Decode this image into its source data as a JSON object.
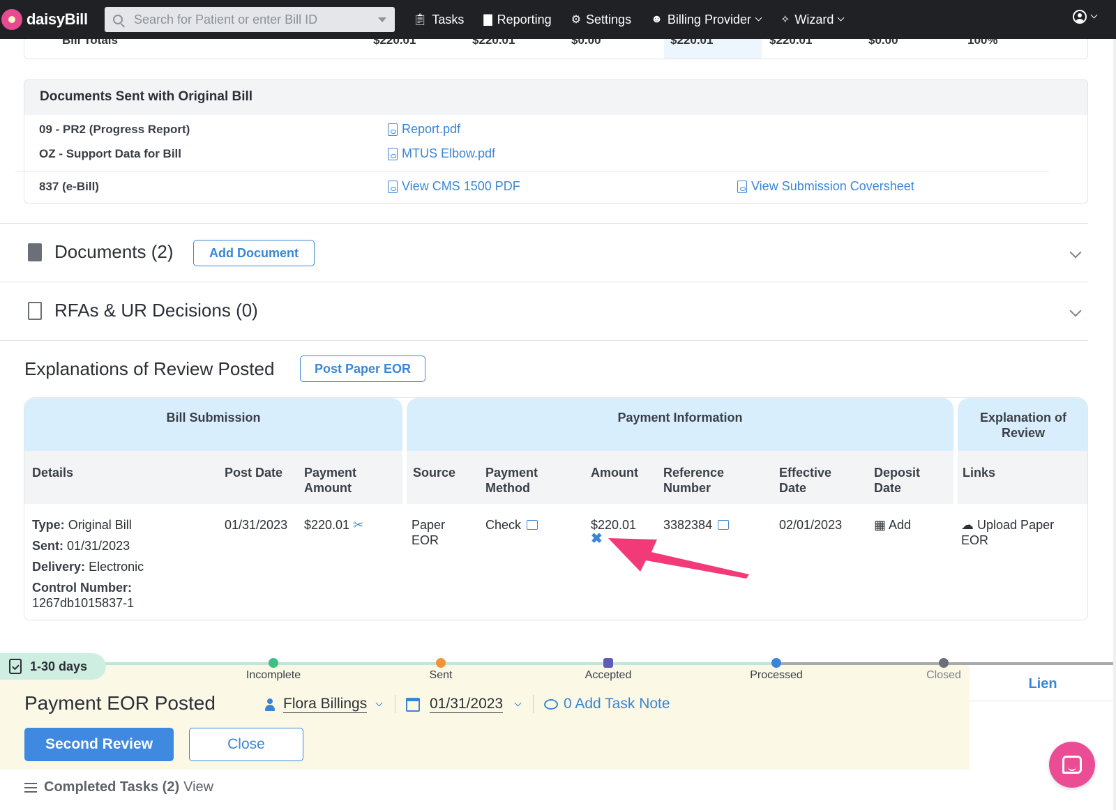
{
  "nav": {
    "brand": "daisyBill",
    "search_placeholder": "Search for Patient or enter Bill ID",
    "items": [
      {
        "label": "Tasks",
        "icon": "clipboard-check-icon"
      },
      {
        "label": "Reporting",
        "icon": "bar-chart-icon"
      },
      {
        "label": "Settings",
        "icon": "gear-icon"
      },
      {
        "label": "Billing Provider",
        "icon": "users-icon"
      },
      {
        "label": "Wizard",
        "icon": "magic-wand-icon"
      }
    ]
  },
  "bill_totals": {
    "label": "Bill Totals",
    "values": [
      "$220.01",
      "$220.01",
      "$0.00",
      "$220.01",
      "$220.01",
      "$0.00",
      "100%"
    ]
  },
  "docs_sent": {
    "title": "Documents Sent with Original Bill",
    "rows": [
      {
        "label": "09 - PR2 (Progress Report)",
        "link": "Report.pdf"
      },
      {
        "label": "OZ - Support Data for Bill",
        "link": "MTUS Elbow.pdf"
      }
    ],
    "ebill": {
      "label": "837 (e-Bill)",
      "link1": "View CMS 1500 PDF",
      "link2": "View Submission Coversheet"
    }
  },
  "documents": {
    "title": "Documents (2)",
    "button": "Add Document"
  },
  "rfas": {
    "title": "RFAs & UR Decisions (0)"
  },
  "eor": {
    "title": "Explanations of Review Posted",
    "button": "Post Paper EOR",
    "groups": [
      "Bill Submission",
      "Payment Information",
      "Explanation of Review"
    ],
    "columns": [
      "Details",
      "Post Date",
      "Payment Amount",
      "Source",
      "Payment Method",
      "Amount",
      "Reference Number",
      "Effective Date",
      "Deposit Date",
      "Links"
    ],
    "row": {
      "type_label": "Type:",
      "type": "Original Bill",
      "sent_label": "Sent:",
      "sent": "01/31/2023",
      "delivery_label": "Delivery:",
      "delivery": "Electronic",
      "control_label": "Control Number:",
      "control": "1267db1015837-1",
      "post_date": "01/31/2023",
      "payment_amount": "$220.01",
      "source": "Paper EOR",
      "payment_method": "Check",
      "amount": "$220.01",
      "reference_number": "3382384",
      "effective_date": "02/01/2023",
      "deposit_date": "Add",
      "links": "Upload Paper EOR"
    }
  },
  "task": {
    "age": "1-30 days",
    "stages": [
      "Incomplete",
      "Sent",
      "Accepted",
      "Processed",
      "Closed"
    ],
    "lien_tab": "Lien",
    "title": "Payment EOR Posted",
    "assignee": "Flora Billings",
    "date": "01/31/2023",
    "note": "0 Add Task Note",
    "primary_button": "Second Review",
    "secondary_button": "Close",
    "completed": "Completed Tasks (2)",
    "completed_link": "View"
  },
  "colors": {
    "accent": "#3a86d6",
    "nav_bg": "#1f2124",
    "highlight_arrow": "#f23a78",
    "task_bg": "#fcf8e6"
  }
}
